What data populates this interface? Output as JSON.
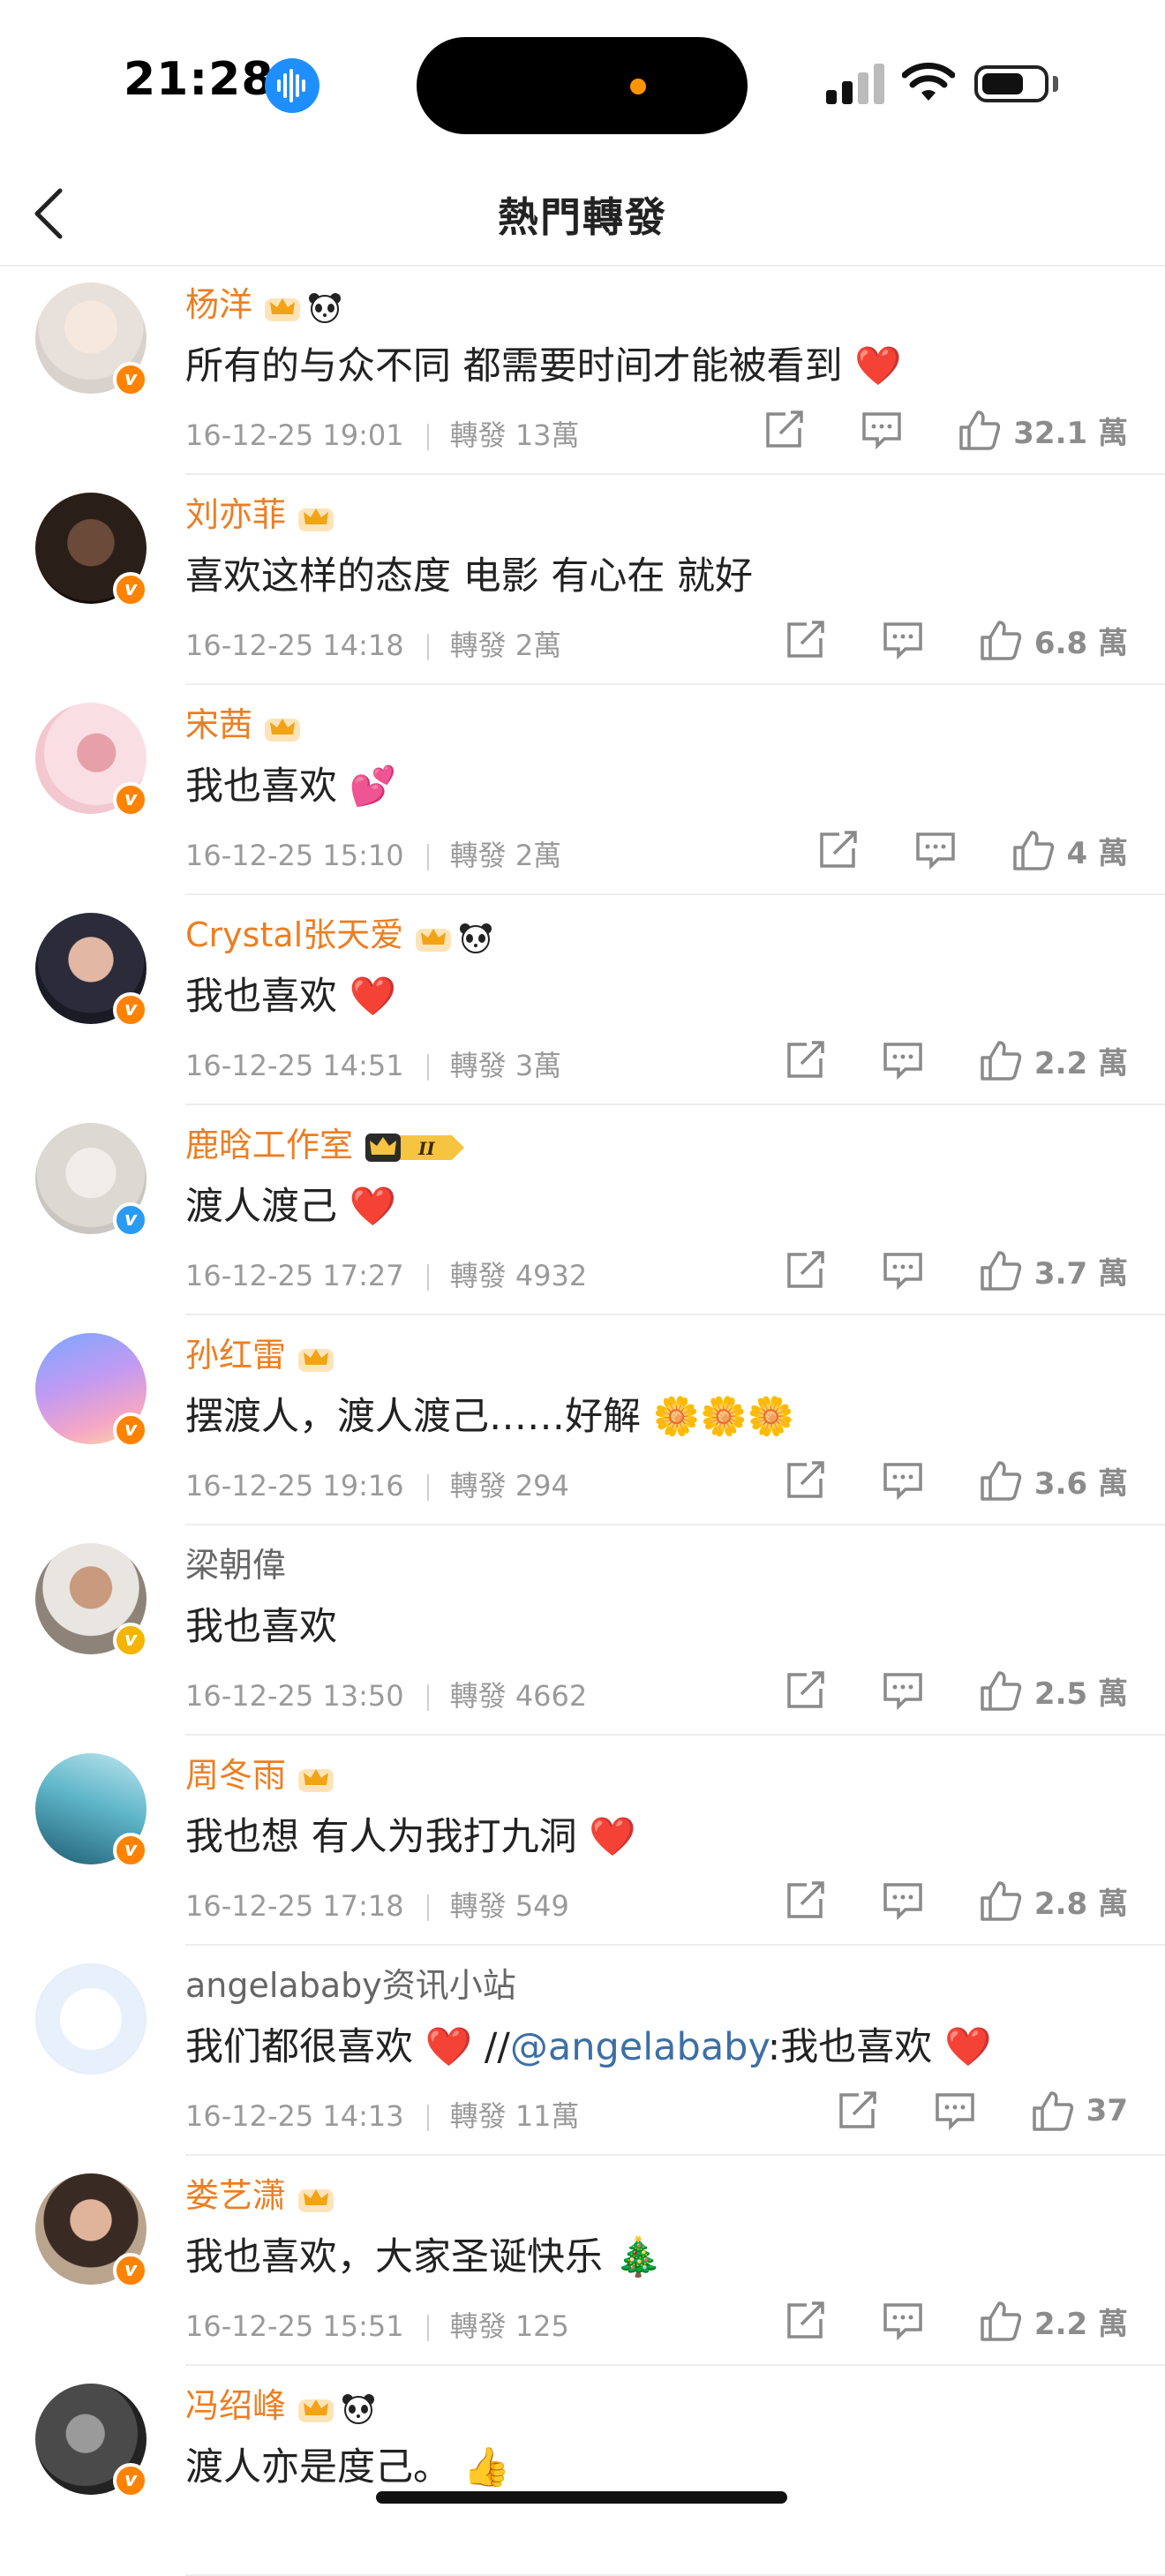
{
  "status_bar": {
    "time": "21:28"
  },
  "nav": {
    "title": "熱門轉發"
  },
  "colors": {
    "name_orange": "#ec7e22",
    "verified_orange": "#ff8200",
    "verified_blue": "#2a9bf3",
    "verified_gold": "#f5b400",
    "mention_blue": "#3d6fa5"
  },
  "icons": [
    "back-chevron-icon",
    "crown-icon",
    "panda-icon",
    "share-icon",
    "comment-icon",
    "like-icon",
    "heart-icon"
  ],
  "reposts": [
    {
      "name": "杨洋",
      "text": "所有的与众不同 都需要时间才能被看到",
      "emoji": "❤️",
      "time": "16-12-25 19:01",
      "repost": "轉發 13萬",
      "likes": "32.1 萬"
    },
    {
      "name": "刘亦菲",
      "text": "喜欢这样的态度 电影 有心在 就好",
      "emoji": "",
      "time": "16-12-25 14:18",
      "repost": "轉發 2萬",
      "likes": "6.8 萬"
    },
    {
      "name": "宋茜",
      "text": "我也喜欢",
      "emoji": "💕",
      "time": "16-12-25 15:10",
      "repost": "轉發 2萬",
      "likes": "4 萬"
    },
    {
      "name": "Crystal张天爱",
      "text": "我也喜欢",
      "emoji": "❤️",
      "time": "16-12-25 14:51",
      "repost": "轉發 3萬",
      "likes": "2.2 萬"
    },
    {
      "name": "鹿晗工作室",
      "text": "渡人渡己",
      "emoji": "❤️",
      "time": "16-12-25 17:27",
      "repost": "轉發 4932",
      "likes": "3.7 萬"
    },
    {
      "name": "孙红雷",
      "text": "摆渡人，渡人渡己……好解",
      "emoji": "🌼🌼🌼",
      "time": "16-12-25 19:16",
      "repost": "轉發 294",
      "likes": "3.6 萬"
    },
    {
      "name": "梁朝偉",
      "text": "我也喜欢",
      "emoji": "",
      "time": "16-12-25 13:50",
      "repost": "轉發 4662",
      "likes": "2.5 萬"
    },
    {
      "name": "周冬雨",
      "text": "我也想 有人为我打九洞",
      "emoji": "❤️",
      "time": "16-12-25 17:18",
      "repost": "轉發 549",
      "likes": "2.8 萬"
    },
    {
      "name": "angelababy资讯小站",
      "text": "我们都很喜欢",
      "emoji": "❤️",
      "text_b": " //",
      "mention": "@angelababy",
      "text_c": ":我也喜欢",
      "emoji_b": "❤️",
      "time": "16-12-25 14:13",
      "repost": "轉發 11萬",
      "likes": "37"
    },
    {
      "name": "娄艺潇",
      "text": "我也喜欢，大家圣诞快乐",
      "emoji": "🎄",
      "time": "16-12-25 15:51",
      "repost": "轉發 125",
      "likes": "2.2 萬"
    },
    {
      "name": "冯绍峰",
      "text": "渡人亦是度己。",
      "emoji": "👍",
      "time": "",
      "repost": "",
      "likes": ""
    }
  ]
}
